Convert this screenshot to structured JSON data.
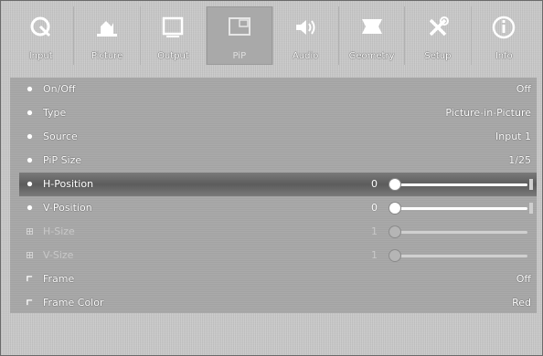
{
  "tabs": [
    {
      "label": "Input",
      "icon": "input-icon"
    },
    {
      "label": "Picture",
      "icon": "picture-icon"
    },
    {
      "label": "Output",
      "icon": "output-icon"
    },
    {
      "label": "PiP",
      "icon": "pip-icon",
      "selected": true
    },
    {
      "label": "Audio",
      "icon": "audio-icon"
    },
    {
      "label": "Geometry",
      "icon": "geometry-icon"
    },
    {
      "label": "Setup",
      "icon": "setup-icon"
    },
    {
      "label": "Info",
      "icon": "info-icon"
    }
  ],
  "menu": {
    "onoff": {
      "label": "On/Off",
      "value": "Off"
    },
    "type": {
      "label": "Type",
      "value": "Picture-in-Picture"
    },
    "source": {
      "label": "Source",
      "value": "Input 1"
    },
    "pip_size": {
      "label": "PiP Size",
      "value": "1/25"
    },
    "h_position": {
      "label": "H-Position",
      "value": "0",
      "fraction": 0.0
    },
    "v_position": {
      "label": "V-Position",
      "value": "0",
      "fraction": 0.0
    },
    "h_size": {
      "label": "H-Size",
      "value": "1",
      "fraction": 0.0
    },
    "v_size": {
      "label": "V-Size",
      "value": "1",
      "fraction": 0.0
    },
    "frame": {
      "label": "Frame",
      "value": "Off"
    },
    "frame_color": {
      "label": "Frame Color",
      "value": "Red"
    }
  },
  "colors": {
    "background": "#c9c9c9",
    "panel": "#a3a3a3",
    "highlight": "#5c5c5c",
    "text": "#ffffff"
  }
}
